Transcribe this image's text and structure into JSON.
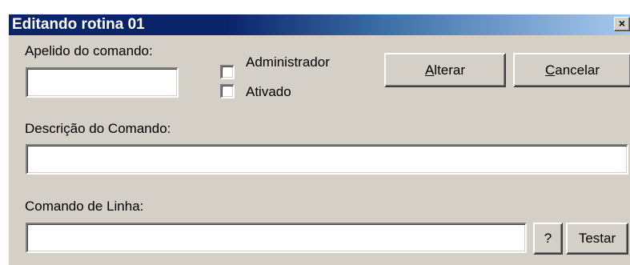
{
  "window": {
    "title": "Editando rotina 01",
    "close_symbol": "×",
    "close_icon": "close-icon"
  },
  "alias": {
    "label": "Apelido do comando:",
    "value": ""
  },
  "checkboxes": [
    {
      "label": "Administrador",
      "checked": false
    },
    {
      "label": "Ativado",
      "checked": false
    }
  ],
  "buttons": {
    "alterar": {
      "mnemonic": "A",
      "rest": "lterar"
    },
    "cancelar": {
      "mnemonic": "C",
      "rest": "ancelar"
    },
    "help": "?",
    "testar": "Testar"
  },
  "description": {
    "label": "Descrição do Comando:",
    "value": ""
  },
  "command_line": {
    "label": "Comando de Linha:",
    "value": ""
  }
}
